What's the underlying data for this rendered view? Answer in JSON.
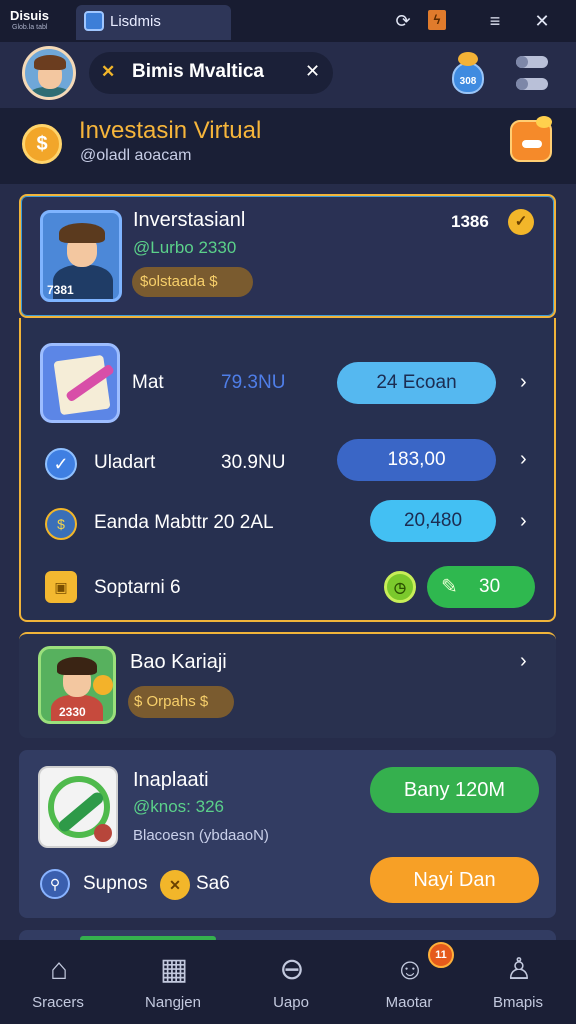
{
  "window": {
    "app_name": "Disuis",
    "app_sub": "Glob.la tabl",
    "tab_label": "Lisdmis"
  },
  "header": {
    "title_pill": "Bimis Mvaltica",
    "pill_left_icon": "close-icon",
    "pill_right_icon": "close-icon",
    "coin_bag_value": "308"
  },
  "banner": {
    "title": "Investasin Virtual",
    "subtitle": "@oladl aoacam"
  },
  "card1": {
    "title": "Inverstasianl",
    "subtitle": "@Lurbo 2330",
    "badge": "$olstaada $",
    "thumb_number": "7381",
    "value": "1386"
  },
  "list": [
    {
      "label": "Mat",
      "amount": "79.3NU",
      "button": "24 Ecoan",
      "button_color": "#55b8f0"
    },
    {
      "label": "Uladart",
      "amount": "30.9NU",
      "button": "183,00",
      "button_color": "#3a66c6"
    },
    {
      "label": "Eanda Mabttr 20 2AL",
      "amount": "",
      "button": "20,480",
      "button_color": "#43c0f3"
    },
    {
      "label": "Soptarni 6",
      "amount": "",
      "button": "30",
      "button_color": "#2fb84f"
    }
  ],
  "card3": {
    "title": "Bao Kariaji",
    "badge": "$ Orpahs $",
    "thumb_number": "2330"
  },
  "card4": {
    "title": "Inaplaati",
    "subtitle": "@knos: 326",
    "note": "Blacoesn (ybdaaoN)",
    "button_primary": "Bany 120M",
    "button_secondary": "Nayi Dan",
    "footer_label": "Supnos",
    "footer_value": "Sa6"
  },
  "nav": [
    {
      "label": "Sracers",
      "icon": "home-icon"
    },
    {
      "label": "Nangjen",
      "icon": "box-icon"
    },
    {
      "label": "Uapo",
      "icon": "minus-circle-icon"
    },
    {
      "label": "Maotar",
      "icon": "users-icon"
    },
    {
      "label": "Bmapis",
      "icon": "profile-icon"
    }
  ],
  "notification_count": "11"
}
